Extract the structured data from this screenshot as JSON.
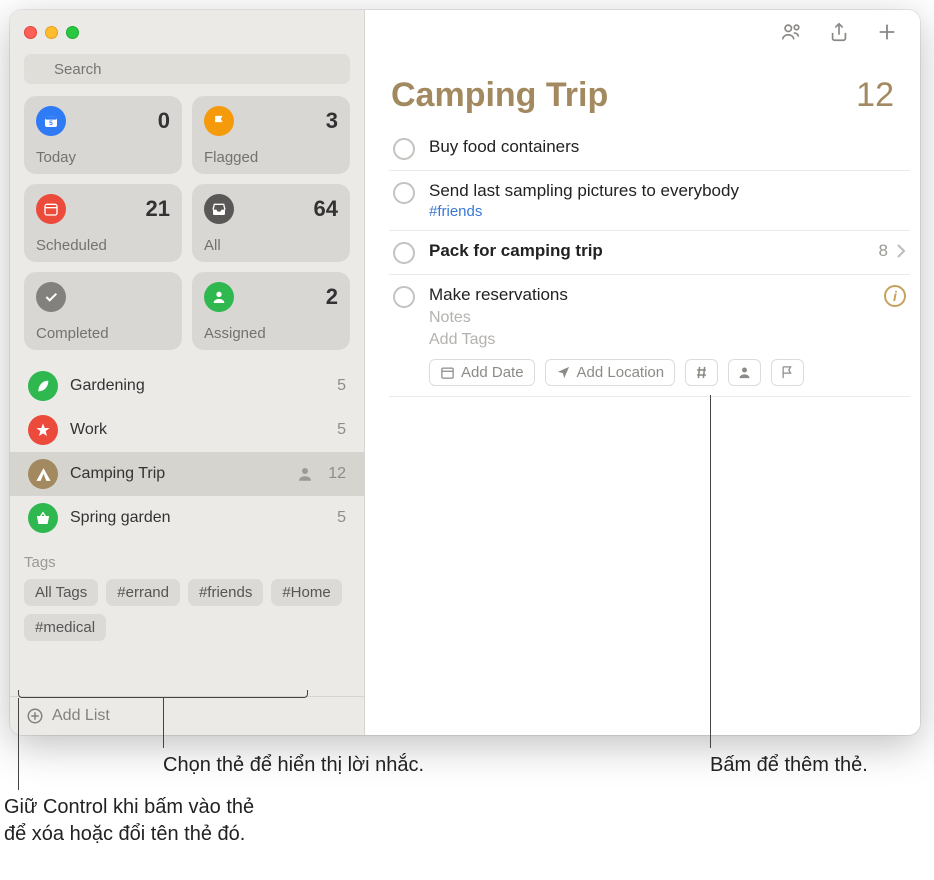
{
  "search": {
    "placeholder": "Search"
  },
  "smart_lists": [
    {
      "label": "Today",
      "count": "0",
      "bg": "#2f7bf6"
    },
    {
      "label": "Flagged",
      "count": "3",
      "bg": "#f59a0b"
    },
    {
      "label": "Scheduled",
      "count": "21",
      "bg": "#ec4b3b"
    },
    {
      "label": "All",
      "count": "64",
      "bg": "#5a5856"
    },
    {
      "label": "Completed",
      "count": "",
      "bg": "#83817d"
    },
    {
      "label": "Assigned",
      "count": "2",
      "bg": "#2fb84f"
    }
  ],
  "lists": [
    {
      "name": "Gardening",
      "count": "5",
      "bg": "#2fb84f",
      "icon": "leaf",
      "shared": false,
      "selected": false
    },
    {
      "name": "Work",
      "count": "5",
      "bg": "#ec4b3b",
      "icon": "star",
      "shared": false,
      "selected": false
    },
    {
      "name": "Camping Trip",
      "count": "12",
      "bg": "#a2895f",
      "icon": "tent",
      "shared": true,
      "selected": true
    },
    {
      "name": "Spring garden",
      "count": "5",
      "bg": "#2fb84f",
      "icon": "basket",
      "shared": false,
      "selected": false
    }
  ],
  "tags_header": "Tags",
  "tags": [
    "All Tags",
    "#errand",
    "#friends",
    "#Home",
    "#medical"
  ],
  "add_list_label": "Add List",
  "main": {
    "title": "Camping Trip",
    "count": "12"
  },
  "reminders": [
    {
      "title": "Buy food containers"
    },
    {
      "title": "Send last sampling pictures to everybody",
      "sub": "#friends"
    },
    {
      "title": "Pack for camping trip",
      "bold": true,
      "right_count": "8",
      "chevron": true
    },
    {
      "title": "Make reservations",
      "editing": true,
      "notes": "Notes",
      "addtags": "Add Tags",
      "pills": {
        "date": "Add Date",
        "location": "Add Location"
      }
    }
  ],
  "callouts": {
    "select_tag": "Chọn thẻ để hiển thị lời nhắc.",
    "add_tag": "Bấm để thêm thẻ.",
    "ctrl_click": "Giữ Control khi bấm vào thẻ\nđể xóa hoặc đổi tên thẻ đó."
  }
}
